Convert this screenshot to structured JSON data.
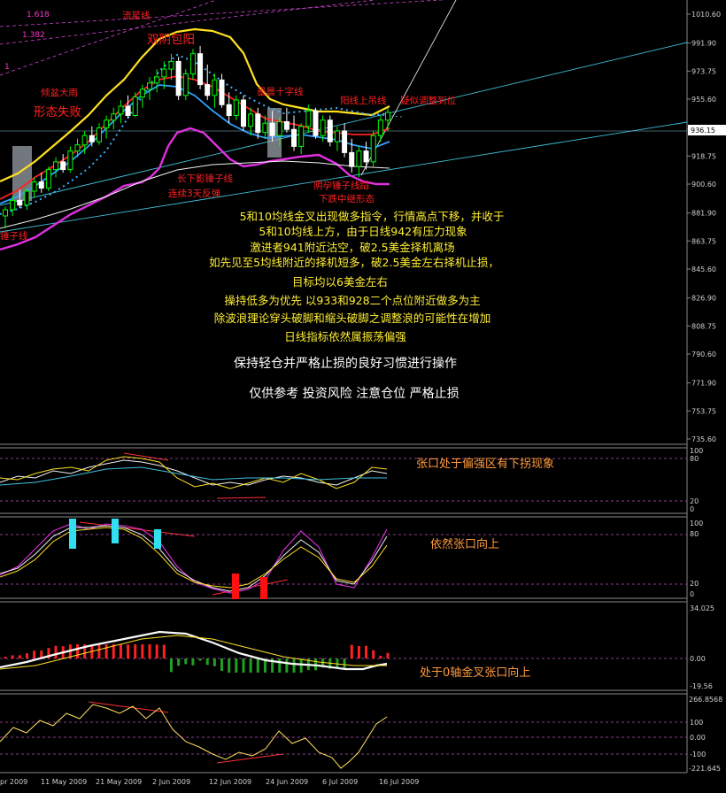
{
  "chart_data": [
    {
      "type": "candlestick",
      "y_ticks": [
        "1010.60",
        "991.90",
        "973.75",
        "955.60",
        "936.15",
        "918.75",
        "900.60",
        "881.90",
        "863.75",
        "845.60",
        "826.90",
        "808.75",
        "790.60",
        "771.90",
        "753.75",
        "735.60"
      ],
      "last_price": "936.15",
      "fib_labels": [
        "1.618",
        "1.382",
        "1"
      ],
      "annotations": {
        "meteor": "流星线",
        "twin_yin": "双阴包阳",
        "engulf": "倾盆大雨",
        "pattern_fail": "形态失败",
        "morning_doji": "墨晨十字线",
        "hanging_man": "阳线上吊线",
        "adjust": "疑似调整到位",
        "long_shadow": "长下影锤子线",
        "three_days": "连续3天反弹",
        "hammer_a": "阴孕锤子线蹈",
        "hammer_b": "下跌中继形态",
        "hammer_left": "锤子线"
      },
      "notes": [
        "5和10均线金叉出现做多指令，行情高点下移，并收于",
        "5和10均线上方，由于日线942有压力现象",
        "激进者941附近沽空，破2.5美金择机离场",
        "如先见至5均线附近的择机短多，破2.5美金左右择机止损，",
        "目标均以6美金左右",
        "操持低多为优先 以933和928二个点位附近做多为主",
        "除波浪理论穿头破脚和缩头破脚之调整浪的可能性在增加",
        "日线指标依然属振荡偏强",
        "保持轻仓并严格止损的良好习惯进行操作",
        "仅供参考 投资风险 注意仓位 严格止损"
      ],
      "candles": [
        [
          880,
          886,
          872,
          884
        ],
        [
          884,
          893,
          880,
          890
        ],
        [
          890,
          897,
          885,
          887
        ],
        [
          887,
          898,
          884,
          896
        ],
        [
          896,
          905,
          892,
          902
        ],
        [
          902,
          908,
          895,
          898
        ],
        [
          898,
          912,
          896,
          910
        ],
        [
          910,
          918,
          905,
          915
        ],
        [
          915,
          920,
          908,
          910
        ],
        [
          910,
          925,
          908,
          922
        ],
        [
          922,
          930,
          918,
          926
        ],
        [
          926,
          935,
          920,
          932
        ],
        [
          932,
          938,
          925,
          928
        ],
        [
          928,
          940,
          926,
          937
        ],
        [
          937,
          945,
          930,
          942
        ],
        [
          942,
          950,
          936,
          946
        ],
        [
          946,
          955,
          940,
          951
        ],
        [
          951,
          958,
          943,
          945
        ],
        [
          945,
          960,
          944,
          957
        ],
        [
          957,
          965,
          950,
          962
        ],
        [
          962,
          970,
          955,
          966
        ],
        [
          966,
          975,
          960,
          970
        ],
        [
          970,
          980,
          962,
          975
        ],
        [
          975,
          985,
          968,
          980
        ],
        [
          980,
          983,
          955,
          958
        ],
        [
          958,
          975,
          955,
          972
        ],
        [
          972,
          988,
          968,
          985
        ],
        [
          985,
          990,
          962,
          965
        ],
        [
          965,
          978,
          955,
          958
        ],
        [
          958,
          972,
          950,
          968
        ],
        [
          968,
          972,
          950,
          952
        ],
        [
          952,
          960,
          940,
          945
        ],
        [
          945,
          958,
          942,
          955
        ],
        [
          955,
          958,
          935,
          938
        ],
        [
          938,
          950,
          932,
          946
        ],
        [
          946,
          950,
          930,
          934
        ],
        [
          934,
          945,
          930,
          940
        ],
        [
          940,
          948,
          928,
          932
        ],
        [
          932,
          944,
          925,
          941
        ],
        [
          941,
          950,
          934,
          936
        ],
        [
          936,
          945,
          922,
          925
        ],
        [
          925,
          940,
          920,
          938
        ],
        [
          938,
          952,
          934,
          948
        ],
        [
          948,
          950,
          930,
          932
        ],
        [
          932,
          945,
          928,
          942
        ],
        [
          942,
          945,
          925,
          928
        ],
        [
          928,
          938,
          922,
          935
        ],
        [
          935,
          940,
          918,
          921
        ],
        [
          921,
          930,
          908,
          912
        ],
        [
          912,
          925,
          905,
          922
        ],
        [
          922,
          928,
          910,
          915
        ],
        [
          915,
          935,
          912,
          932
        ],
        [
          932,
          945,
          928,
          942
        ],
        [
          942,
          950,
          935,
          947
        ]
      ],
      "moving_averages": [
        "yellow",
        "red",
        "blue",
        "dotted",
        "magenta",
        "white"
      ]
    },
    {
      "type": "line",
      "panel": "oscillator-1",
      "y_ticks": [
        "100",
        "80",
        "20",
        "0"
      ],
      "note": "张口处于偏强区有下拐现象"
    },
    {
      "type": "line",
      "panel": "stochastic",
      "y_ticks": [
        "100",
        "80",
        "20",
        "0"
      ],
      "note": "依然张口向上"
    },
    {
      "type": "bar",
      "panel": "macd",
      "y_ticks": [
        "34.025",
        "0.00",
        "-19.56"
      ],
      "note": "处于0轴金叉张口向上"
    },
    {
      "type": "line",
      "panel": "cci",
      "y_ticks": [
        "266.8568",
        "100",
        "0.00",
        "-100",
        "-221.645"
      ]
    }
  ],
  "x_dates": [
    "pr 2009",
    "11 May 2009",
    "21 May 2009",
    "2 Jun 2009",
    "12 Jun 2009",
    "24 Jun 2009",
    "6 Jul 2009",
    "16 Jul 2009"
  ],
  "colors": {
    "bull": "#00ff00",
    "bear": "#ffffff",
    "grid": "#808080",
    "note_white": "#ffffff",
    "note_yellow": "#ffee33",
    "note_orange": "#ff9a3c",
    "annotation_red": "#ff2020"
  }
}
